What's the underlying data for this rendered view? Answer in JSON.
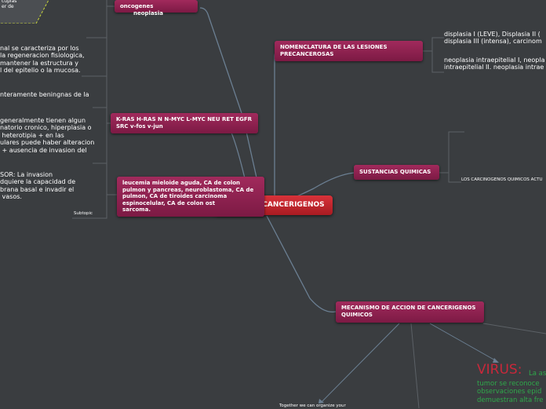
{
  "central": "AGENTES CANCERIGENOS",
  "nodes": {
    "oncogenes": "oncogenes",
    "neoplasia": "neoplasia",
    "kras": "K-RAS H-RAS N N-MYC L-MYC NEU RET EGFR\nSRC v-fos v-jun",
    "leucemia": "leucemia mieloide aguda, CA de colon\npulmon y pancreas, neuroblastoma, CA de\npulmon, CA de tiroides carcinoma\nespinocelular, CA de colon ost\nsarcoma.",
    "nomenclatura": "NOMENCLATURA DE LAS LESIONES\nPRECANCEROSAS",
    "sustancias": "SUSTANCIAS QUIMICAS",
    "mecanismo": "MECANISMO DE ACCION DE CANCERIGENOS\nQUIMICOS"
  },
  "left_texts": {
    "top_fragment": "cuplas\ner de",
    "caracteriza": "nal se caracteriza por los\nla regeneracion fisiologica,\nmantener la estructura y\nl del epitelio o la mucosa.",
    "benignas": "nteramente beningnas de la",
    "generalmente": "generalmente tienen algun\nnatorio cronico, hiperplasia o\n heterotipia + en las\nulares puede haber alteracion\n + ausencia de invasion del",
    "sor": "SOR: La invasion\ndquiere la capacidad de\nbrana basal e invadir el\n vasos.",
    "subtopic": "Subtopic"
  },
  "right_texts": {
    "displasia": "displasia I (LEVE), Displasia II (\ndisplasia III (intensa), carcinom",
    "neoplasia_intra": "neoplasia intraepitelial I, neopla\nintraepitelial II. neoplasia intrae",
    "carcinogenos": "LOS CARCINOGENOS QUIMICOS ACTU",
    "together": "Together we can organize your"
  },
  "virus": {
    "title": "VIRUS:",
    "line1_suffix": "La as",
    "body": "tumor se reconoce\nobservaciones epid\ndemuestran alta fre"
  },
  "colors": {
    "background": "#3a3d40",
    "node": "#8f2150",
    "central": "#c42830",
    "virus_title": "#c8283a",
    "virus_text": "#2fa84a"
  }
}
